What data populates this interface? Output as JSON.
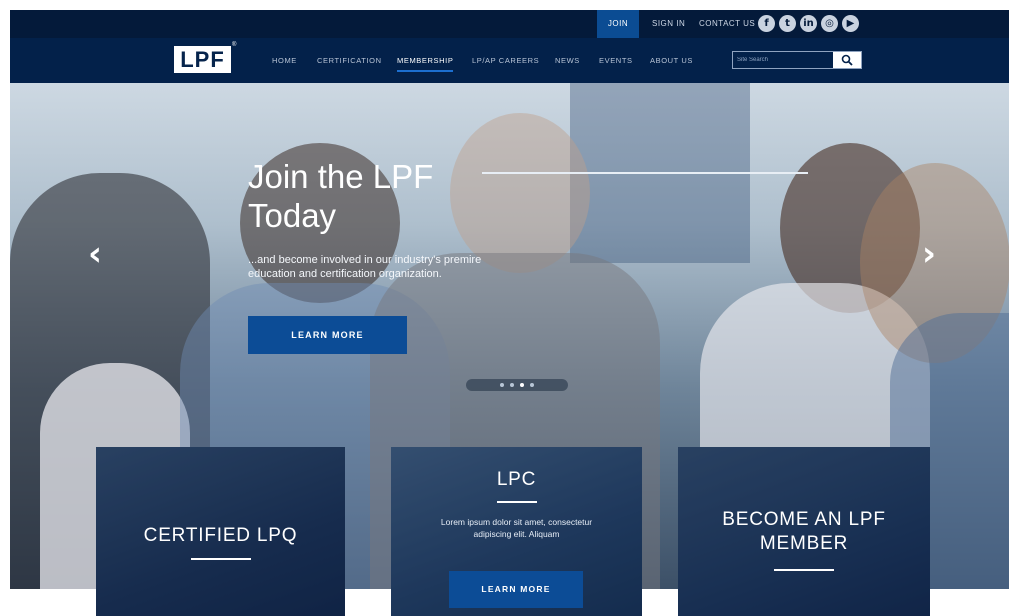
{
  "utility_nav": {
    "join": "JOIN",
    "sign_in": "SIGN IN",
    "contact": "CONTACT US",
    "social": [
      {
        "icon": "facebook-icon",
        "glyph": "f"
      },
      {
        "icon": "twitter-icon",
        "glyph": "t"
      },
      {
        "icon": "linkedin-icon",
        "glyph": "in"
      },
      {
        "icon": "instagram-icon",
        "glyph": "◎"
      },
      {
        "icon": "youtube-icon",
        "glyph": "▶"
      }
    ]
  },
  "brand": {
    "logo": "LPF",
    "trademark": "®"
  },
  "main_nav": {
    "items": [
      "HOME",
      "CERTIFICATION",
      "MEMBERSHIP",
      "LP/AP CAREERS",
      "NEWS",
      "EVENTS",
      "ABOUT US"
    ],
    "active": "MEMBERSHIP"
  },
  "search": {
    "placeholder": "Site Search",
    "icon": "search-icon"
  },
  "hero": {
    "title_line1": "Join the LPF",
    "title_line2": "Today",
    "subtitle": "...and become involved in our industry's premire education and certification organization.",
    "button": "LEARN MORE",
    "slide_count": 4,
    "active_slide": 3
  },
  "cards": [
    {
      "title": "CERTIFIED LPQ"
    },
    {
      "title": "LPC",
      "text": "Lorem ipsum dolor sit amet, consectetur adipiscing elit. Aliquam",
      "button": "LEARN MORE"
    },
    {
      "title_line1": "BECOME AN LPF",
      "title_line2": "MEMBER"
    }
  ],
  "colors": {
    "top_bar": "#041a3a",
    "nav_bar": "#03214a",
    "accent_blue": "#0c4c96"
  }
}
